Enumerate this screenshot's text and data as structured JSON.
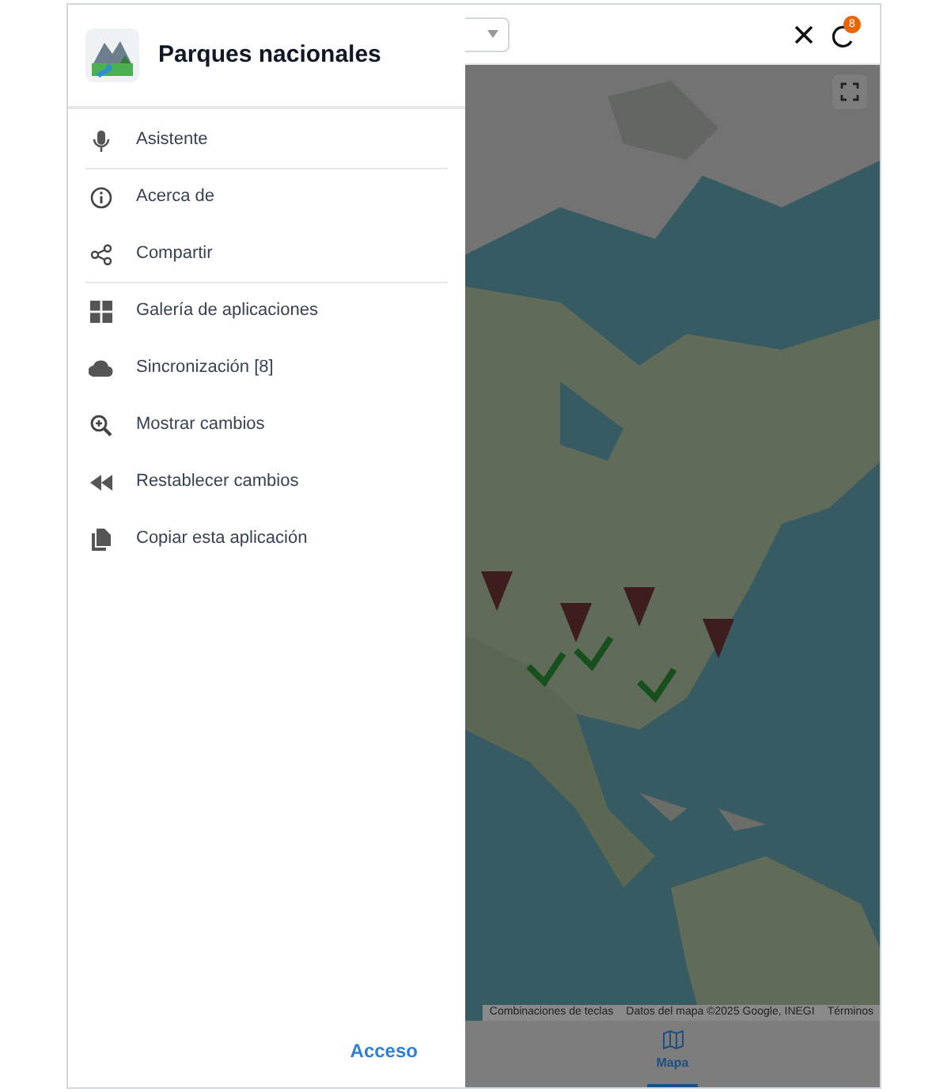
{
  "drawer": {
    "title": "Parques nacionales",
    "items": [
      {
        "label": "Asistente",
        "divider_after": true
      },
      {
        "label": "Acerca de",
        "divider_after": false
      },
      {
        "label": "Compartir",
        "divider_after": true
      },
      {
        "label": "Galería de aplicaciones",
        "divider_after": false
      },
      {
        "label": "Sincronización [8]",
        "divider_after": false
      },
      {
        "label": "Mostrar cambios",
        "divider_after": false
      },
      {
        "label": "Restablecer cambios",
        "divider_after": false
      },
      {
        "label": "Copiar esta aplicación",
        "divider_after": false
      }
    ],
    "login": "Acceso"
  },
  "top_bar": {
    "sync_badge": "8"
  },
  "map": {
    "kind": "picture",
    "attribution": [
      "Combinaciones de teclas",
      "Datos del mapa ©2025 Google, INEGI",
      "Términos"
    ]
  },
  "bottom_nav": [
    {
      "label": "Mapa",
      "selected": true
    }
  ]
}
